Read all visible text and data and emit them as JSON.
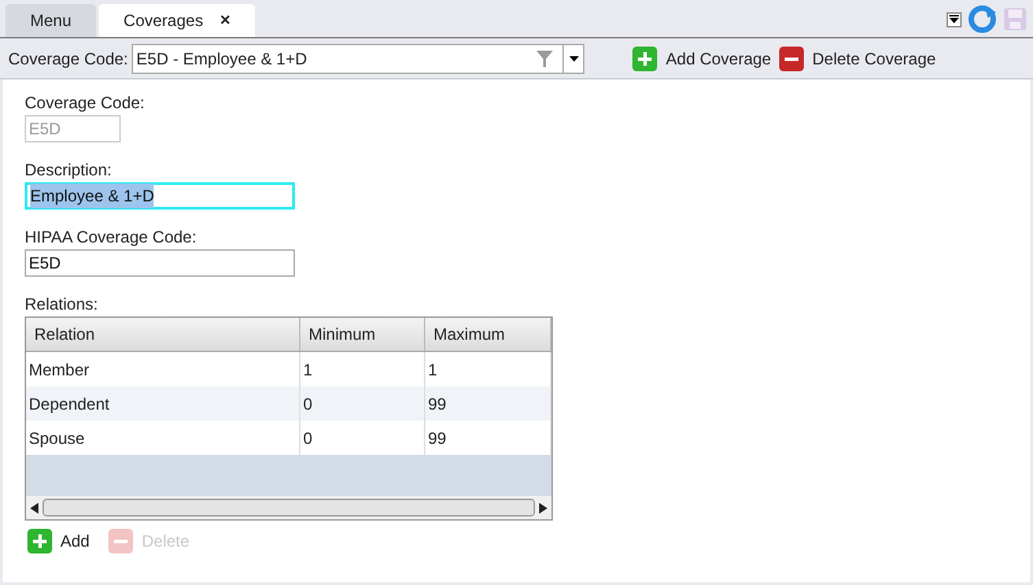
{
  "tabs": [
    {
      "label": "Menu",
      "selected": false,
      "closable": false
    },
    {
      "label": "Coverages",
      "selected": true,
      "closable": true,
      "close": "✕"
    }
  ],
  "toolbar": {
    "label": "Coverage Code:",
    "value": "E5D - Employee & 1+D",
    "buttons": [
      {
        "label": "Add Coverage",
        "kind": "add",
        "disabled": false
      },
      {
        "label": "Delete Coverage",
        "kind": "delete",
        "disabled": false
      }
    ]
  },
  "form": [
    {
      "label": "Coverage Code:",
      "value": "E5D",
      "disabled": true,
      "focused": false,
      "wide": false
    },
    {
      "label": "Description:",
      "value": "Employee & 1+D",
      "disabled": false,
      "focused": true,
      "wide": true
    },
    {
      "label": "HIPAA Coverage Code:",
      "value": "E5D",
      "disabled": false,
      "focused": false,
      "wide": true
    }
  ],
  "relations": {
    "label": "Relations:",
    "columns": [
      "Relation",
      "Minimum",
      "Maximum"
    ],
    "rows": [
      [
        "Member",
        "1",
        "1"
      ],
      [
        "Dependent",
        "0",
        "99"
      ],
      [
        "Spouse",
        "0",
        "99"
      ]
    ],
    "buttons": [
      {
        "label": "Add",
        "kind": "add",
        "disabled": false
      },
      {
        "label": "Delete",
        "kind": "delete",
        "disabled": true
      }
    ]
  }
}
